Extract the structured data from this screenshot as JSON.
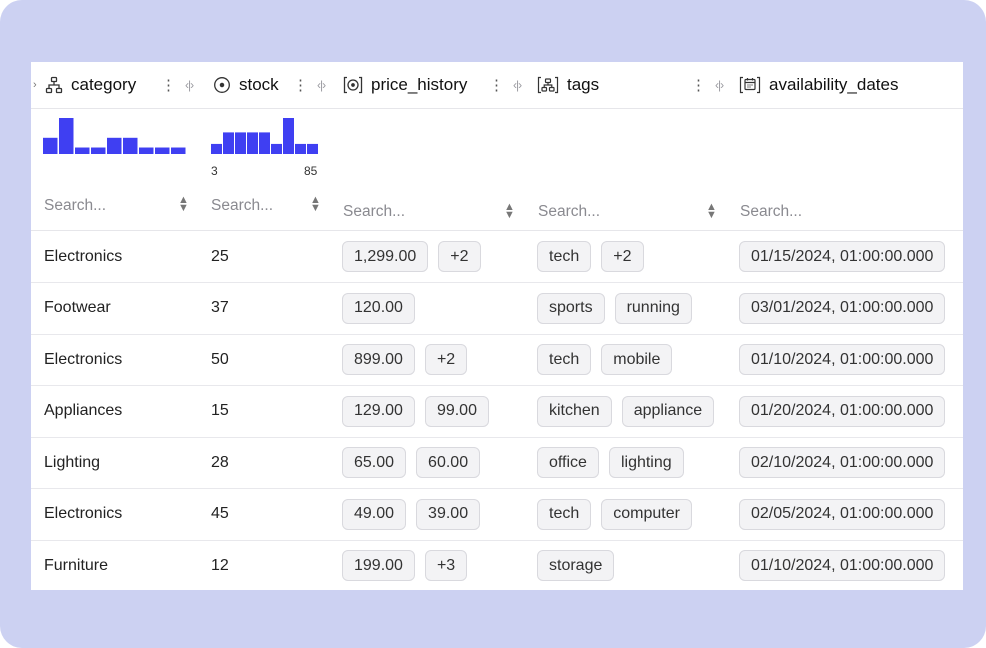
{
  "columns": {
    "category": {
      "label": "category",
      "search_placeholder": "Search..."
    },
    "stock": {
      "label": "stock",
      "search_placeholder": "Search...",
      "hist_min": "3",
      "hist_max": "85"
    },
    "price_history": {
      "label": "price_history",
      "search_placeholder": "Search..."
    },
    "tags": {
      "label": "tags",
      "search_placeholder": "Search..."
    },
    "availability_dates": {
      "label": "availability_dates",
      "search_placeholder": "Search..."
    }
  },
  "histograms": {
    "category": [
      0.45,
      1.0,
      0.18,
      0.18,
      0.45,
      0.45,
      0.18,
      0.18,
      0.18
    ],
    "stock": [
      0.28,
      0.6,
      0.6,
      0.6,
      0.6,
      0.28,
      1.0,
      0.28,
      0.28
    ]
  },
  "rows": [
    {
      "category": "Electronics",
      "stock": "25",
      "price": [
        "1,299.00",
        "+2"
      ],
      "tags": [
        "tech",
        "+2"
      ],
      "date": "01/15/2024, 01:00:00.000"
    },
    {
      "category": "Footwear",
      "stock": "37",
      "price": [
        "120.00"
      ],
      "tags": [
        "sports",
        "running"
      ],
      "date": "03/01/2024, 01:00:00.000"
    },
    {
      "category": "Electronics",
      "stock": "50",
      "price": [
        "899.00",
        "+2"
      ],
      "tags": [
        "tech",
        "mobile"
      ],
      "date": "01/10/2024, 01:00:00.000"
    },
    {
      "category": "Appliances",
      "stock": "15",
      "price": [
        "129.00",
        "99.00"
      ],
      "tags": [
        "kitchen",
        "appliance"
      ],
      "date": "01/20/2024, 01:00:00.000"
    },
    {
      "category": "Lighting",
      "stock": "28",
      "price": [
        "65.00",
        "60.00"
      ],
      "tags": [
        "office",
        "lighting"
      ],
      "date": "02/10/2024, 01:00:00.000"
    },
    {
      "category": "Electronics",
      "stock": "45",
      "price": [
        "49.00",
        "39.00"
      ],
      "tags": [
        "tech",
        "computer"
      ],
      "date": "02/05/2024, 01:00:00.000"
    },
    {
      "category": "Furniture",
      "stock": "12",
      "price": [
        "199.00",
        "+3"
      ],
      "tags": [
        "storage"
      ],
      "date": "01/10/2024, 01:00:00.000"
    }
  ],
  "colors": {
    "accent": "#3f3ff2",
    "frame": "#ccd1f2"
  }
}
